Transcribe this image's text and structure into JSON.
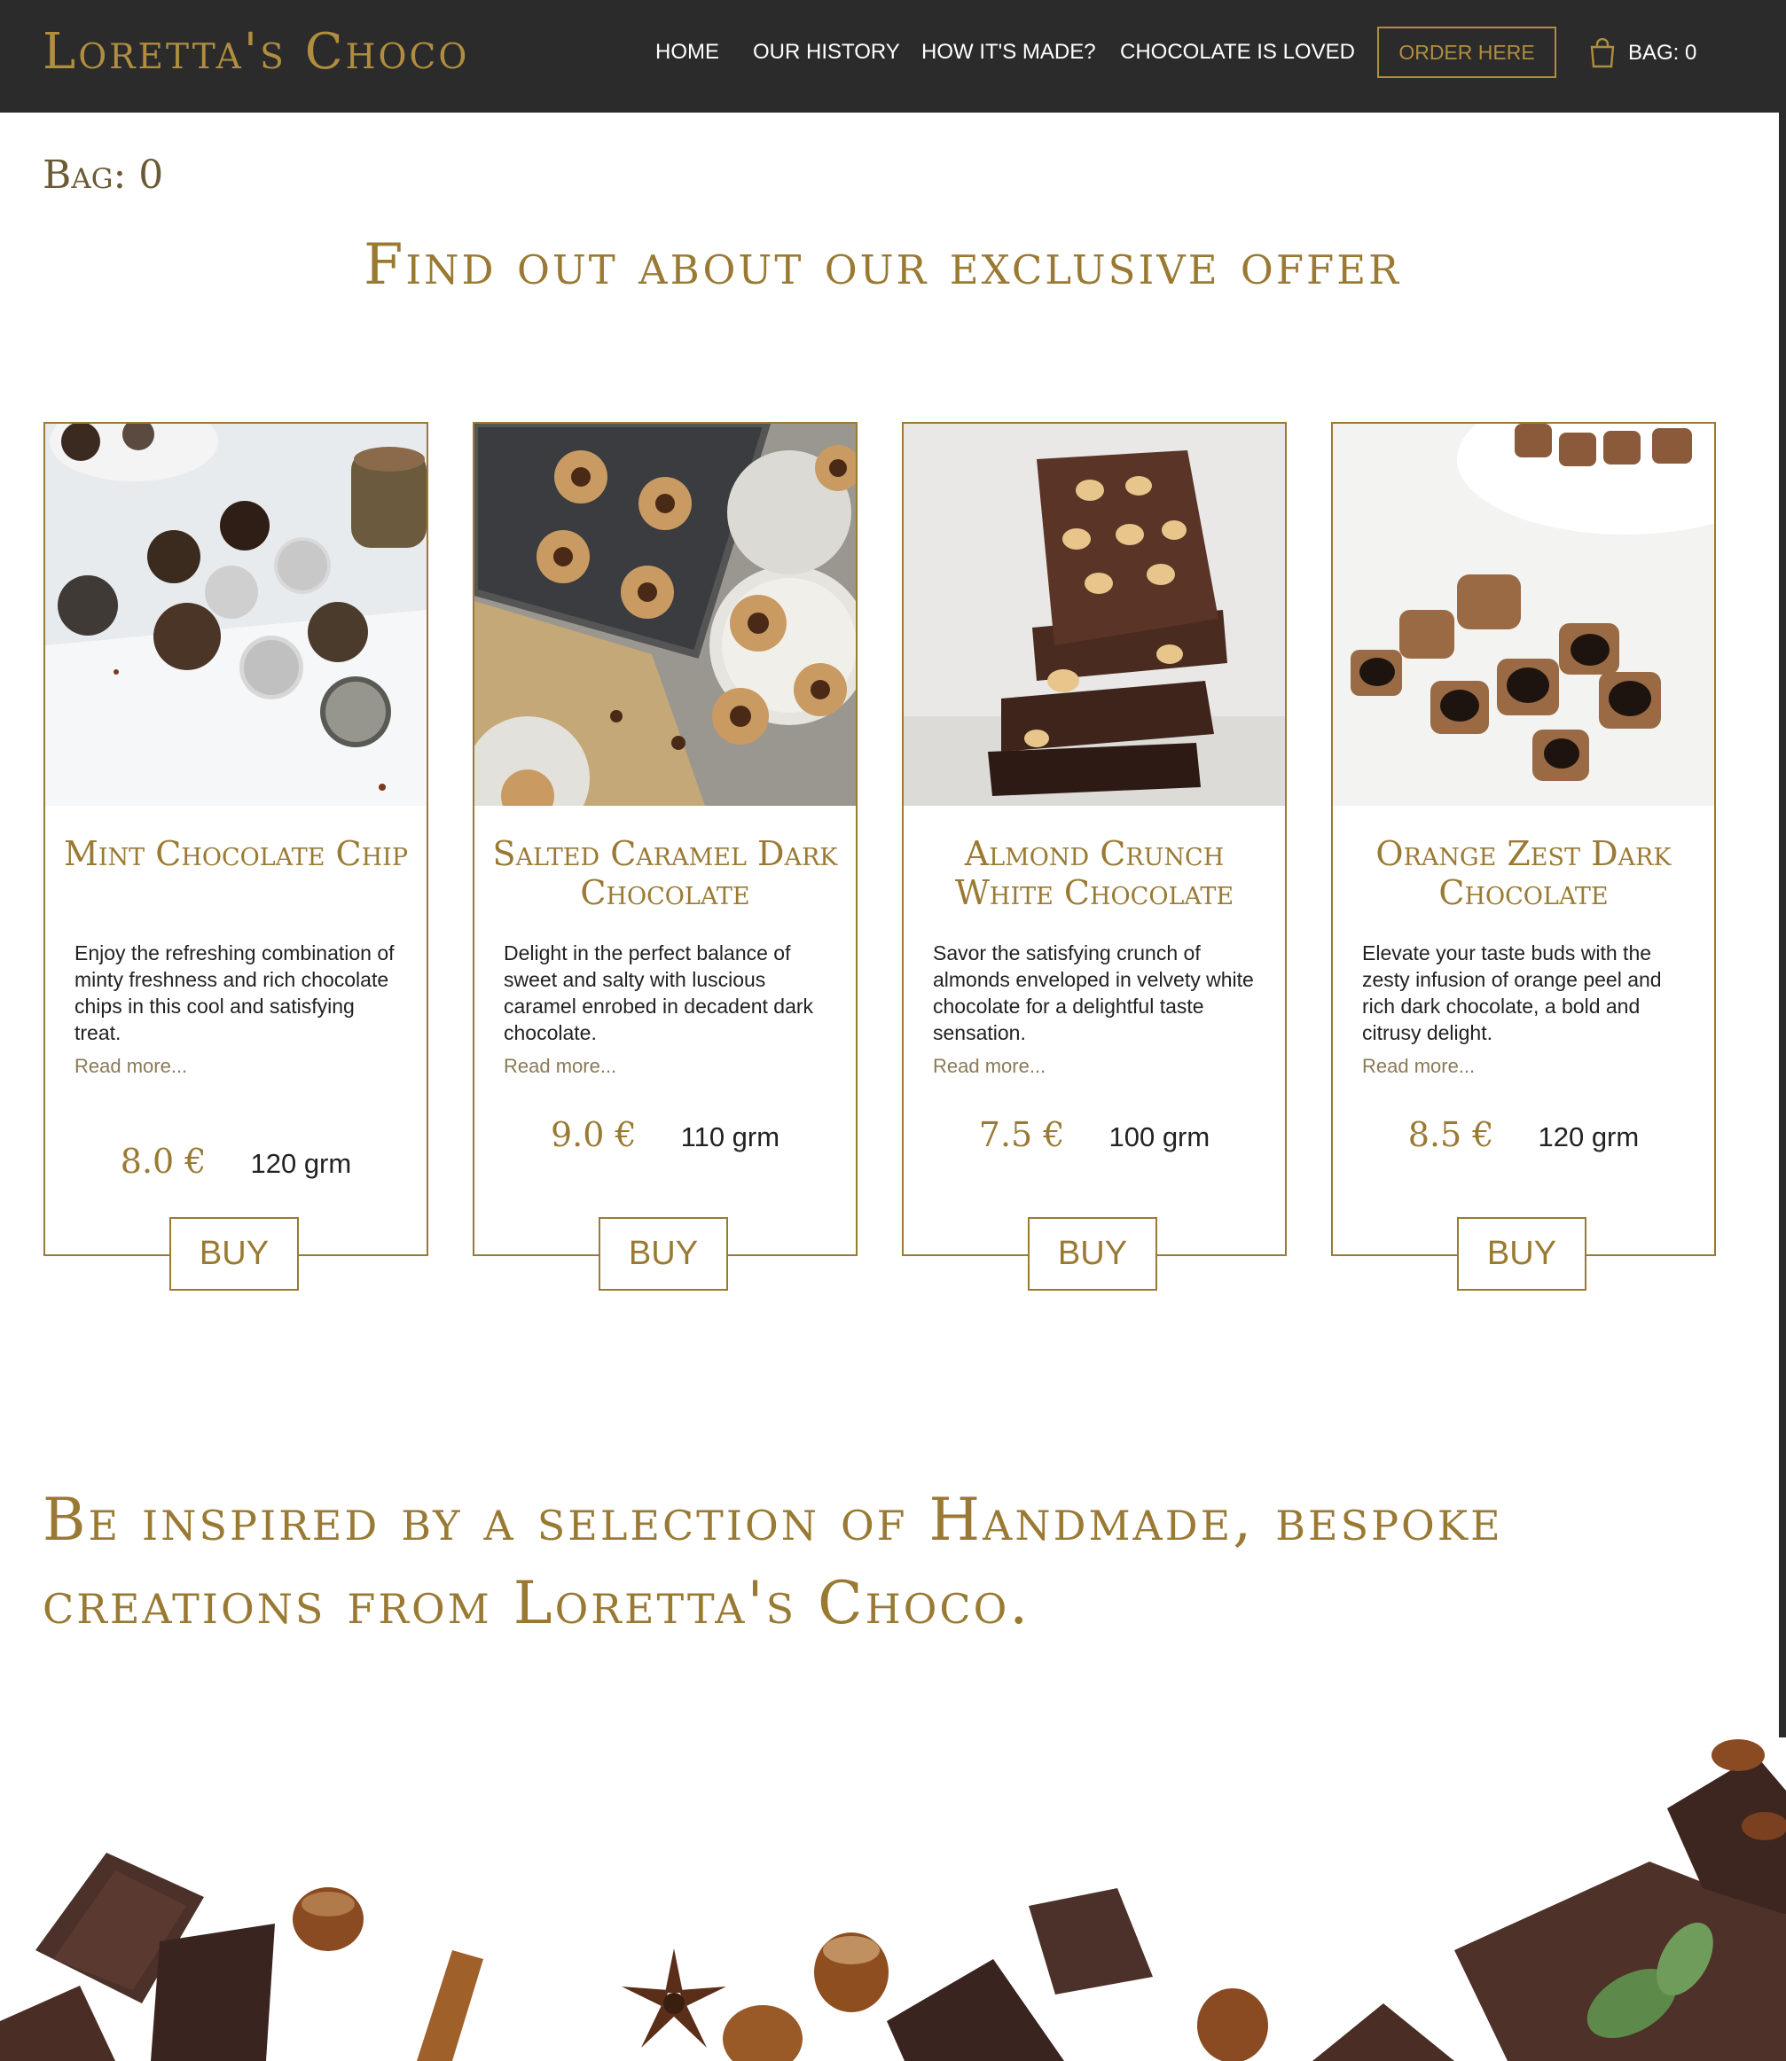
{
  "brand": {
    "logo": "Loretta's Choco"
  },
  "nav": {
    "items": [
      "Home",
      "Our History",
      "How it's made?",
      "Chocolate is loved"
    ],
    "order_label": "ORDER HERE",
    "bag_label": "BAG: 0"
  },
  "bag_line": "Bag: 0",
  "offer_title": "Find out about our exclusive offer",
  "products": [
    {
      "title": "Mint Chocolate Chip",
      "description": "Enjoy the refreshing combination of minty freshness and rich chocolate chips in this cool and satisfying treat.",
      "read_more": "Read more...",
      "price": "8.0 €",
      "weight": "120 grm",
      "buy": "BUY"
    },
    {
      "title": "Salted Caramel Dark Chocolate",
      "description": "Delight in the perfect balance of sweet and salty with luscious caramel enrobed in decadent dark chocolate.",
      "read_more": "Read more...",
      "price": "9.0 €",
      "weight": "110 grm",
      "buy": "BUY"
    },
    {
      "title": "Almond Crunch White Chocolate",
      "description": "Savor the satisfying crunch of almonds enveloped in velvety white chocolate for a delightful taste sensation.",
      "read_more": "Read more...",
      "price": "7.5 €",
      "weight": "100 grm",
      "buy": "BUY"
    },
    {
      "title": "Orange Zest Dark Chocolate",
      "description": "Elevate your taste buds with the zesty infusion of orange peel and rich dark chocolate, a bold and citrusy delight.",
      "read_more": "Read more...",
      "price": "8.5 €",
      "weight": "120 grm",
      "buy": "BUY"
    }
  ],
  "inspire_text": "Be inspired by a selection of Handmade, bespoke creations from Loretta's Choco.",
  "colors": {
    "header_bg": "#2b2b2b",
    "gold": "#9a7a33",
    "gold_light": "#b08d3f"
  }
}
